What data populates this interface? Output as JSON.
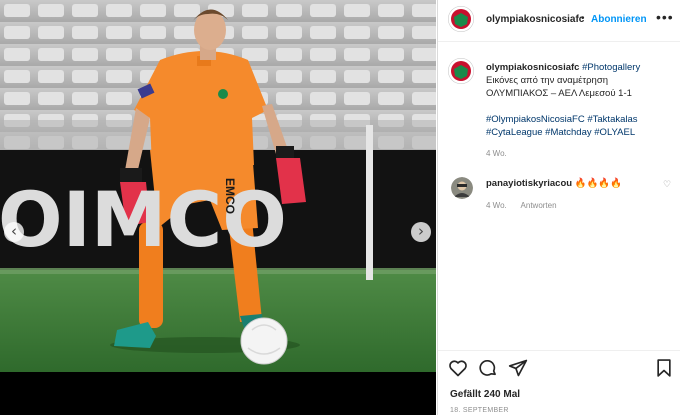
{
  "photo": {
    "sponsor_text": "OIMCO",
    "jersey_text": "EMCO",
    "left_arrow": "‹",
    "right_arrow": "›"
  },
  "header": {
    "username": "olympiakosnicosiafc",
    "separator": "•",
    "follow_label": "Abonnieren",
    "more_label": "•••"
  },
  "caption": {
    "username": "olympiakosnicosiafc",
    "first_tag": "#Photogallery",
    "line2": "Εικόνες από την αναμέτρηση",
    "line3": "ΟΛΥΜΠΙΑΚΟΣ – ΑΕΛ Λεμεσού 1-1",
    "tags_line1": "#OlympiakosNicosiaFC #Taktakalas",
    "tags_line2": "#CytaLeague #Matchday #OLYAEL",
    "time": "4 Wo."
  },
  "comment": {
    "username": "panayiotiskyriacou",
    "text": "🔥🔥🔥🔥",
    "time": "4 Wo.",
    "reply_label": "Antworten",
    "heart_icon": "♡"
  },
  "footer": {
    "likes": "Gefällt 240 Mal",
    "date": "18. SEPTEMBER"
  },
  "colors": {
    "link_blue": "#0095f6",
    "hashtag": "#00376b",
    "kit_orange": "#f58a2c",
    "pitch_green": "#3e7d3a",
    "club_green": "#1a8a4a"
  }
}
